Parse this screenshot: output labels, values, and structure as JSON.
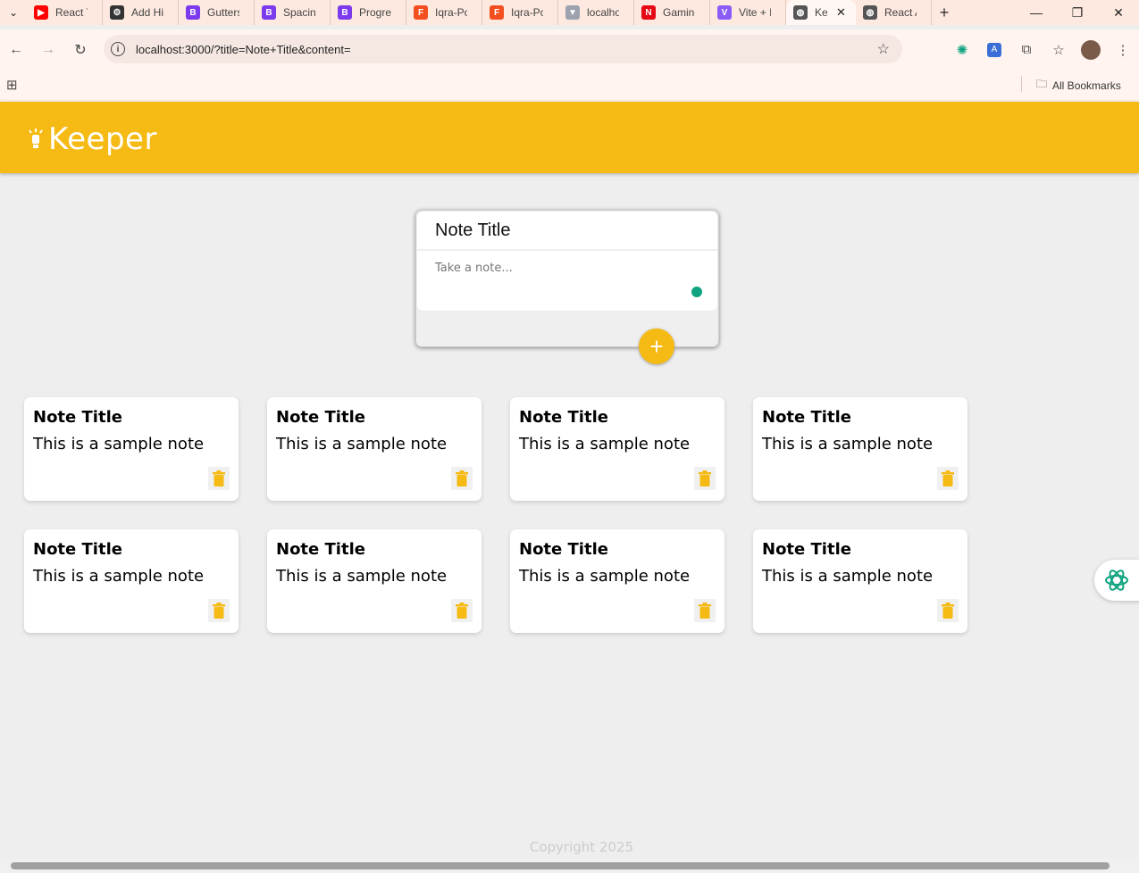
{
  "browser": {
    "tabs": [
      {
        "label": "React T",
        "color": "#ff0000",
        "glyph": "▶"
      },
      {
        "label": "Add Hi",
        "color": "#333333",
        "glyph": "⚙"
      },
      {
        "label": "Gutters",
        "color": "#7c3aed",
        "glyph": "B"
      },
      {
        "label": "Spacing",
        "color": "#7c3aed",
        "glyph": "B"
      },
      {
        "label": "Progre",
        "color": "#7c3aed",
        "glyph": "B"
      },
      {
        "label": "Iqra-Po",
        "color": "#f24e1e",
        "glyph": "F"
      },
      {
        "label": "Iqra-Po",
        "color": "#f24e1e",
        "glyph": "F"
      },
      {
        "label": "localho",
        "color": "#9ca3af",
        "glyph": "▼"
      },
      {
        "label": "Gaming",
        "color": "#e50914",
        "glyph": "N"
      },
      {
        "label": "Vite + I",
        "color": "#8b5cf6",
        "glyph": "V"
      },
      {
        "label": "Ke",
        "color": "#555555",
        "glyph": "◍",
        "active": true
      },
      {
        "label": "React A",
        "color": "#555555",
        "glyph": "◍"
      }
    ],
    "url": "localhost:3000/?title=Note+Title&content=",
    "bookmarks_label": "All Bookmarks"
  },
  "app": {
    "logo": "Keeper",
    "create": {
      "title_value": "Note Title",
      "content_placeholder": "Take a note...",
      "add_label": "+"
    },
    "notes": [
      {
        "title": "Note Title",
        "content": "This is a sample note"
      },
      {
        "title": "Note Title",
        "content": "This is a sample note"
      },
      {
        "title": "Note Title",
        "content": "This is a sample note"
      },
      {
        "title": "Note Title",
        "content": "This is a sample note"
      },
      {
        "title": "Note Title",
        "content": "This is a sample note"
      },
      {
        "title": "Note Title",
        "content": "This is a sample note"
      },
      {
        "title": "Note Title",
        "content": "This is a sample note"
      },
      {
        "title": "Note Title",
        "content": "This is a sample note"
      }
    ],
    "footer": "Copyright 2025",
    "accent": "#f5ba13"
  }
}
